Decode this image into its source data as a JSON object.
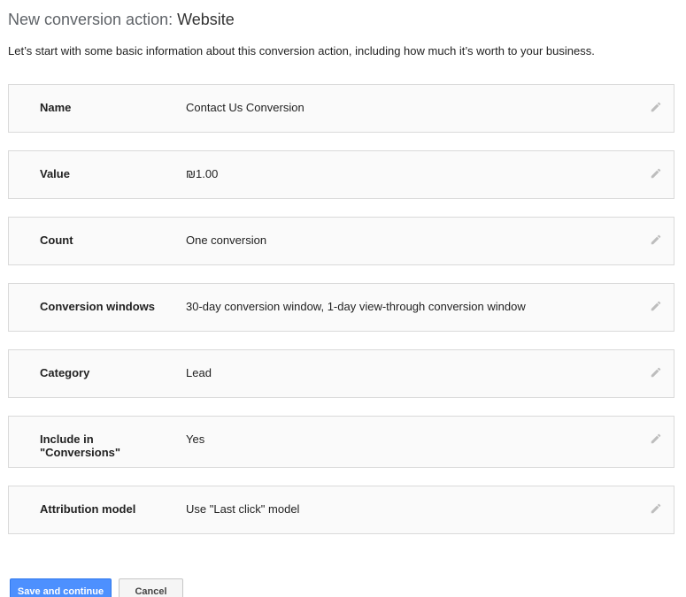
{
  "header": {
    "title_prefix": "New conversion action:",
    "title_type": "Website",
    "description": "Let’s start with some basic information about this conversion action, including how much it’s worth to your business."
  },
  "settings": [
    {
      "label": "Name",
      "value": "Contact Us Conversion"
    },
    {
      "label": "Value",
      "value": "₪1.00"
    },
    {
      "label": "Count",
      "value": "One conversion"
    },
    {
      "label": "Conversion windows",
      "value": "30-day conversion window, 1-day view-through conversion window"
    },
    {
      "label": "Category",
      "value": "Lead"
    },
    {
      "label": "Include in \"Conversions\"",
      "value": "Yes"
    },
    {
      "label": "Attribution model",
      "value": "Use \"Last click\" model"
    }
  ],
  "actions": {
    "save_label": "Save and continue",
    "cancel_label": "Cancel"
  },
  "icons": {
    "edit": "pencil-icon"
  },
  "colors": {
    "primary_button": "#4d90fe",
    "row_background": "#fafafa",
    "row_border": "#dadada"
  }
}
